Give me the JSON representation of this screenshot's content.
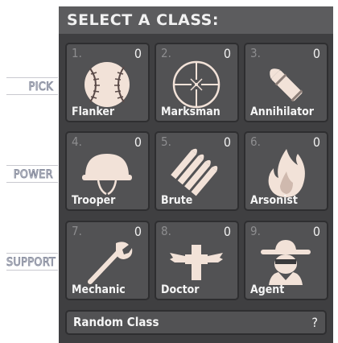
{
  "header": {
    "title": "SELECT A CLASS:"
  },
  "groups": [
    "PICK",
    "POWER",
    "SUPPORT"
  ],
  "classes": [
    {
      "num": "1.",
      "count": "0",
      "name": "Flanker",
      "icon": "baseball-icon"
    },
    {
      "num": "2.",
      "count": "0",
      "name": "Marksman",
      "icon": "crosshair-icon"
    },
    {
      "num": "3.",
      "count": "0",
      "name": "Annihilator",
      "icon": "shell-icon"
    },
    {
      "num": "4.",
      "count": "0",
      "name": "Trooper",
      "icon": "helmet-icon"
    },
    {
      "num": "5.",
      "count": "0",
      "name": "Brute",
      "icon": "bullets-icon"
    },
    {
      "num": "6.",
      "count": "0",
      "name": "Arsonist",
      "icon": "flame-icon"
    },
    {
      "num": "7.",
      "count": "0",
      "name": "Mechanic",
      "icon": "wrench-icon"
    },
    {
      "num": "8.",
      "count": "0",
      "name": "Doctor",
      "icon": "winged-cross-icon"
    },
    {
      "num": "9.",
      "count": "0",
      "name": "Agent",
      "icon": "spy-icon"
    }
  ],
  "random": {
    "label": "Random Class",
    "hint": "?"
  },
  "colors": {
    "icon": "#f2e2d8",
    "panel": "#3f3f41",
    "header": "#5c5c5e"
  }
}
